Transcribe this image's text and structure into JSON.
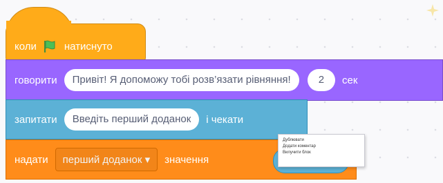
{
  "hat": {
    "prefix": "коли",
    "suffix": "натиснуто",
    "flag_color": "#4cbf56"
  },
  "say": {
    "verb": "говорити",
    "message": "Привіт! Я допоможу тобі розв’язати рівняння!",
    "seconds": "2",
    "unit": "сек"
  },
  "ask": {
    "verb": "запитати",
    "question": "Введіть перший доданок",
    "suffix": "і чекати"
  },
  "set": {
    "verb": "надати",
    "variable": "перший доданок ▾",
    "value_label": "значення"
  },
  "context_menu": {
    "items": [
      "Дублювати",
      "Додати коментар",
      "Вилучити блок"
    ]
  },
  "colors": {
    "events": "#ffab19",
    "looks": "#9966ff",
    "sensing": "#5cb1d6",
    "variables": "#ff8c1a"
  }
}
